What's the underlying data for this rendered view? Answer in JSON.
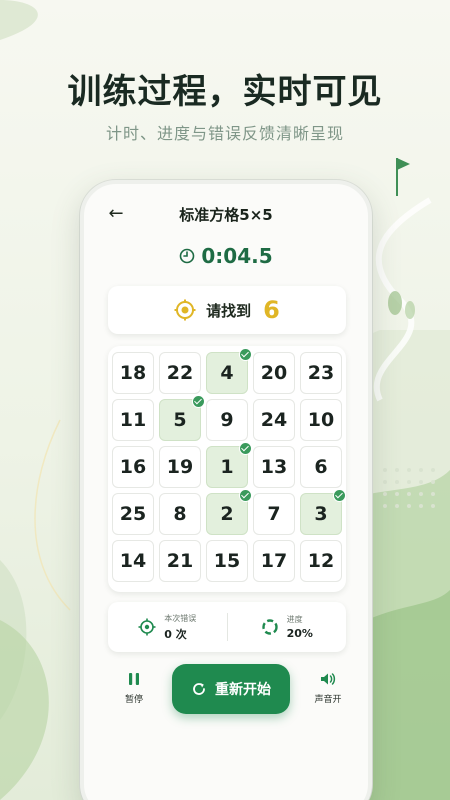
{
  "headline": "训练过程，实时可见",
  "subline": "计时、进度与错误反馈清晰呈现",
  "colors": {
    "accent": "#1f8a4f",
    "target": "#e0b626",
    "found_bg": "#e3f0dd",
    "check": "#3a9a5c"
  },
  "nav": {
    "back_icon": "arrow-left-icon",
    "title": "标准方格5×5"
  },
  "timer": {
    "icon": "clock-icon",
    "text": "0:04.5"
  },
  "target": {
    "icon": "target-icon",
    "label": "请找到",
    "number": "6"
  },
  "grid": {
    "rows": [
      [
        {
          "n": "18",
          "found": false
        },
        {
          "n": "22",
          "found": false
        },
        {
          "n": "4",
          "found": true
        },
        {
          "n": "20",
          "found": false
        },
        {
          "n": "23",
          "found": false
        }
      ],
      [
        {
          "n": "11",
          "found": false
        },
        {
          "n": "5",
          "found": true
        },
        {
          "n": "9",
          "found": false
        },
        {
          "n": "24",
          "found": false
        },
        {
          "n": "10",
          "found": false
        }
      ],
      [
        {
          "n": "16",
          "found": false
        },
        {
          "n": "19",
          "found": false
        },
        {
          "n": "1",
          "found": true
        },
        {
          "n": "13",
          "found": false
        },
        {
          "n": "6",
          "found": false
        }
      ],
      [
        {
          "n": "25",
          "found": false
        },
        {
          "n": "8",
          "found": false
        },
        {
          "n": "2",
          "found": true
        },
        {
          "n": "7",
          "found": false
        },
        {
          "n": "3",
          "found": true
        }
      ],
      [
        {
          "n": "14",
          "found": false
        },
        {
          "n": "21",
          "found": false
        },
        {
          "n": "15",
          "found": false
        },
        {
          "n": "17",
          "found": false
        },
        {
          "n": "12",
          "found": false
        }
      ]
    ]
  },
  "stats": {
    "errors": {
      "icon": "crosshair-icon",
      "label": "本次错误",
      "value": "0 次"
    },
    "progress": {
      "icon": "progress-ring-icon",
      "label": "进度",
      "value": "20%"
    }
  },
  "controls": {
    "pause": {
      "icon": "pause-icon",
      "label": "暂停"
    },
    "restart": {
      "icon": "refresh-icon",
      "label": "重新开始"
    },
    "sound": {
      "icon": "speaker-icon",
      "label": "声音开"
    }
  }
}
